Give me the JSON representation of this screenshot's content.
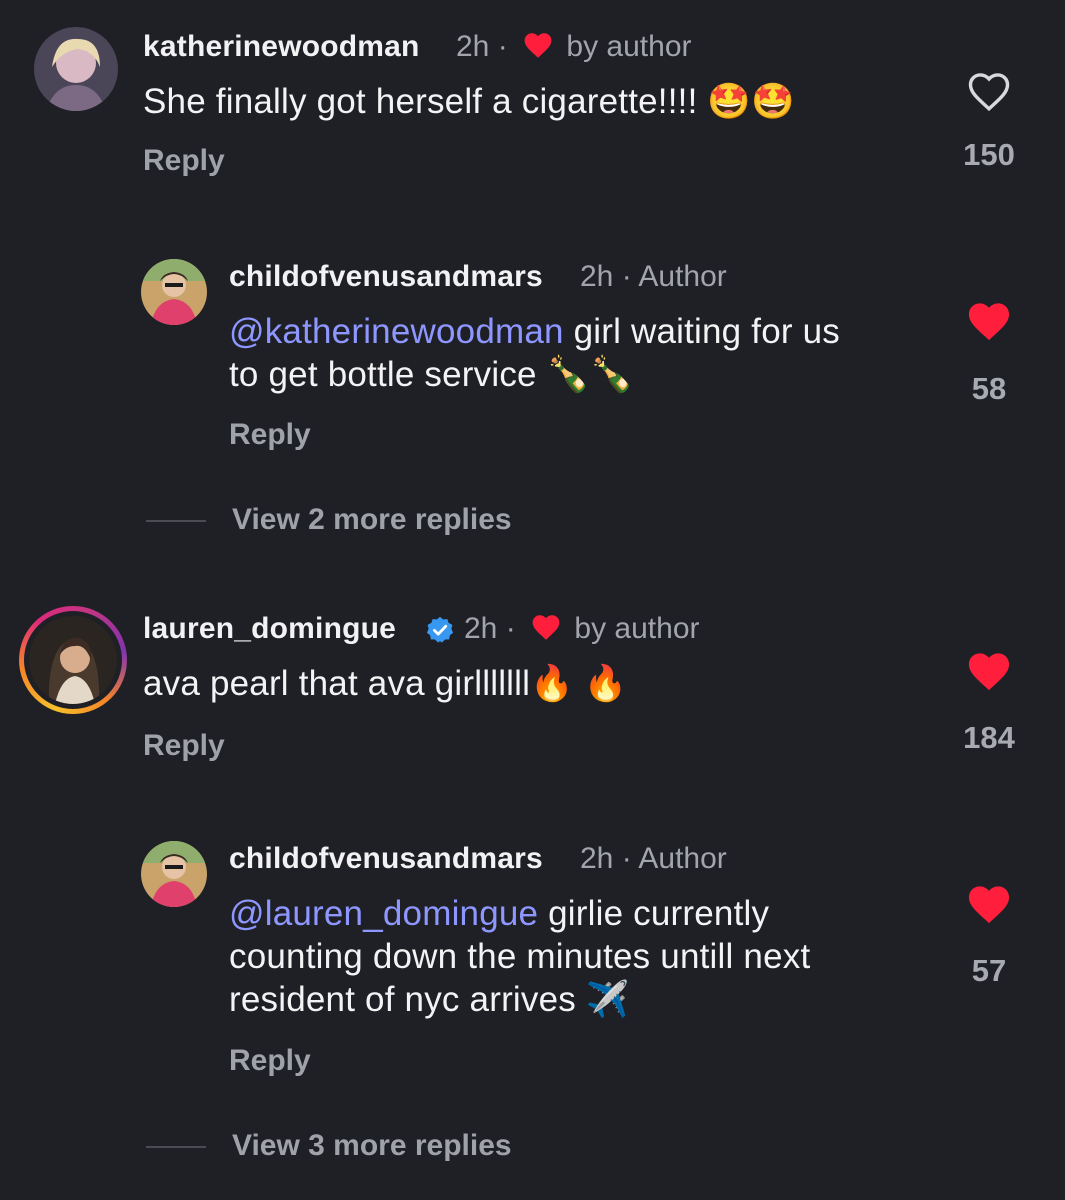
{
  "comments": [
    {
      "username": "katherinewoodman",
      "time": "2h",
      "separator": "·",
      "liked_by": "by author",
      "text": "She finally got herself a cigarette!!!! 🤩🤩",
      "reply_label": "Reply",
      "like_count": "150",
      "liked": false
    },
    {
      "username": "childofvenusandmars",
      "time": "2h",
      "separator": "·",
      "author_badge": "Author",
      "mention": "@katherinewoodman",
      "text_line1": " girl waiting for us",
      "text_line2": "to get bottle service 🍾🍾",
      "reply_label": "Reply",
      "like_count": "58",
      "liked": true
    },
    {
      "username": "lauren_domingue",
      "verified": true,
      "time": "2h",
      "separator": "·",
      "liked_by": "by author",
      "text": "ava pearl that ava girlllllll🔥 🔥",
      "reply_label": "Reply",
      "like_count": "184",
      "liked": true
    },
    {
      "username": "childofvenusandmars",
      "time": "2h",
      "separator": "·",
      "author_badge": "Author",
      "mention": "@lauren_domingue",
      "text_line1": " girlie currently",
      "text_line2": "counting down the minutes untill next",
      "text_line3": "resident of nyc arrives ✈️",
      "reply_label": "Reply",
      "like_count": "57",
      "liked": true
    }
  ],
  "view_more": [
    "View 2 more replies",
    "View 3 more replies"
  ],
  "colors": {
    "background": "#1f2025",
    "heart_red": "#ff1f3d",
    "mention": "#8e97ff",
    "muted": "#a0a2aa",
    "verified_blue": "#3897f0"
  },
  "icons": {
    "heart_outline": "heart-outline-icon",
    "heart_filled": "heart-filled-icon",
    "verified": "verified-badge-icon"
  }
}
